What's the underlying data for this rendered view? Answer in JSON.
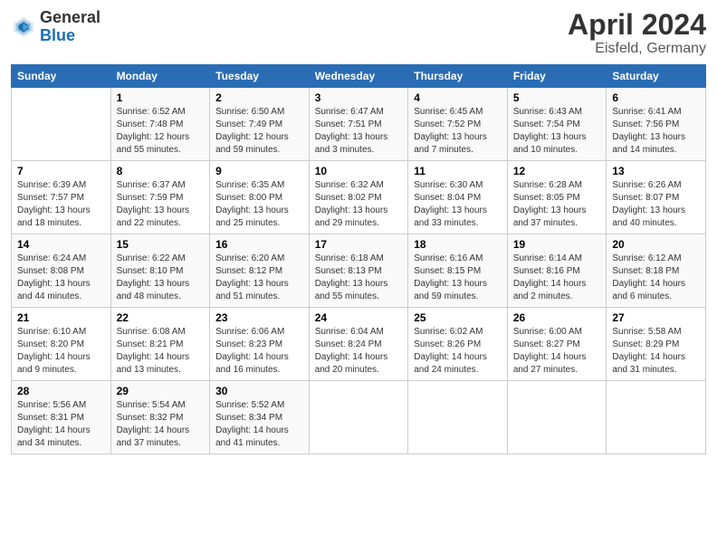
{
  "header": {
    "logo_text_general": "General",
    "logo_text_blue": "Blue",
    "title": "April 2024",
    "subtitle": "Eisfeld, Germany"
  },
  "calendar": {
    "days_of_week": [
      "Sunday",
      "Monday",
      "Tuesday",
      "Wednesday",
      "Thursday",
      "Friday",
      "Saturday"
    ],
    "weeks": [
      [
        {
          "day": "",
          "info": ""
        },
        {
          "day": "1",
          "info": "Sunrise: 6:52 AM\nSunset: 7:48 PM\nDaylight: 12 hours\nand 55 minutes."
        },
        {
          "day": "2",
          "info": "Sunrise: 6:50 AM\nSunset: 7:49 PM\nDaylight: 12 hours\nand 59 minutes."
        },
        {
          "day": "3",
          "info": "Sunrise: 6:47 AM\nSunset: 7:51 PM\nDaylight: 13 hours\nand 3 minutes."
        },
        {
          "day": "4",
          "info": "Sunrise: 6:45 AM\nSunset: 7:52 PM\nDaylight: 13 hours\nand 7 minutes."
        },
        {
          "day": "5",
          "info": "Sunrise: 6:43 AM\nSunset: 7:54 PM\nDaylight: 13 hours\nand 10 minutes."
        },
        {
          "day": "6",
          "info": "Sunrise: 6:41 AM\nSunset: 7:56 PM\nDaylight: 13 hours\nand 14 minutes."
        }
      ],
      [
        {
          "day": "7",
          "info": "Sunrise: 6:39 AM\nSunset: 7:57 PM\nDaylight: 13 hours\nand 18 minutes."
        },
        {
          "day": "8",
          "info": "Sunrise: 6:37 AM\nSunset: 7:59 PM\nDaylight: 13 hours\nand 22 minutes."
        },
        {
          "day": "9",
          "info": "Sunrise: 6:35 AM\nSunset: 8:00 PM\nDaylight: 13 hours\nand 25 minutes."
        },
        {
          "day": "10",
          "info": "Sunrise: 6:32 AM\nSunset: 8:02 PM\nDaylight: 13 hours\nand 29 minutes."
        },
        {
          "day": "11",
          "info": "Sunrise: 6:30 AM\nSunset: 8:04 PM\nDaylight: 13 hours\nand 33 minutes."
        },
        {
          "day": "12",
          "info": "Sunrise: 6:28 AM\nSunset: 8:05 PM\nDaylight: 13 hours\nand 37 minutes."
        },
        {
          "day": "13",
          "info": "Sunrise: 6:26 AM\nSunset: 8:07 PM\nDaylight: 13 hours\nand 40 minutes."
        }
      ],
      [
        {
          "day": "14",
          "info": "Sunrise: 6:24 AM\nSunset: 8:08 PM\nDaylight: 13 hours\nand 44 minutes."
        },
        {
          "day": "15",
          "info": "Sunrise: 6:22 AM\nSunset: 8:10 PM\nDaylight: 13 hours\nand 48 minutes."
        },
        {
          "day": "16",
          "info": "Sunrise: 6:20 AM\nSunset: 8:12 PM\nDaylight: 13 hours\nand 51 minutes."
        },
        {
          "day": "17",
          "info": "Sunrise: 6:18 AM\nSunset: 8:13 PM\nDaylight: 13 hours\nand 55 minutes."
        },
        {
          "day": "18",
          "info": "Sunrise: 6:16 AM\nSunset: 8:15 PM\nDaylight: 13 hours\nand 59 minutes."
        },
        {
          "day": "19",
          "info": "Sunrise: 6:14 AM\nSunset: 8:16 PM\nDaylight: 14 hours\nand 2 minutes."
        },
        {
          "day": "20",
          "info": "Sunrise: 6:12 AM\nSunset: 8:18 PM\nDaylight: 14 hours\nand 6 minutes."
        }
      ],
      [
        {
          "day": "21",
          "info": "Sunrise: 6:10 AM\nSunset: 8:20 PM\nDaylight: 14 hours\nand 9 minutes."
        },
        {
          "day": "22",
          "info": "Sunrise: 6:08 AM\nSunset: 8:21 PM\nDaylight: 14 hours\nand 13 minutes."
        },
        {
          "day": "23",
          "info": "Sunrise: 6:06 AM\nSunset: 8:23 PM\nDaylight: 14 hours\nand 16 minutes."
        },
        {
          "day": "24",
          "info": "Sunrise: 6:04 AM\nSunset: 8:24 PM\nDaylight: 14 hours\nand 20 minutes."
        },
        {
          "day": "25",
          "info": "Sunrise: 6:02 AM\nSunset: 8:26 PM\nDaylight: 14 hours\nand 24 minutes."
        },
        {
          "day": "26",
          "info": "Sunrise: 6:00 AM\nSunset: 8:27 PM\nDaylight: 14 hours\nand 27 minutes."
        },
        {
          "day": "27",
          "info": "Sunrise: 5:58 AM\nSunset: 8:29 PM\nDaylight: 14 hours\nand 31 minutes."
        }
      ],
      [
        {
          "day": "28",
          "info": "Sunrise: 5:56 AM\nSunset: 8:31 PM\nDaylight: 14 hours\nand 34 minutes."
        },
        {
          "day": "29",
          "info": "Sunrise: 5:54 AM\nSunset: 8:32 PM\nDaylight: 14 hours\nand 37 minutes."
        },
        {
          "day": "30",
          "info": "Sunrise: 5:52 AM\nSunset: 8:34 PM\nDaylight: 14 hours\nand 41 minutes."
        },
        {
          "day": "",
          "info": ""
        },
        {
          "day": "",
          "info": ""
        },
        {
          "day": "",
          "info": ""
        },
        {
          "day": "",
          "info": ""
        }
      ]
    ]
  }
}
